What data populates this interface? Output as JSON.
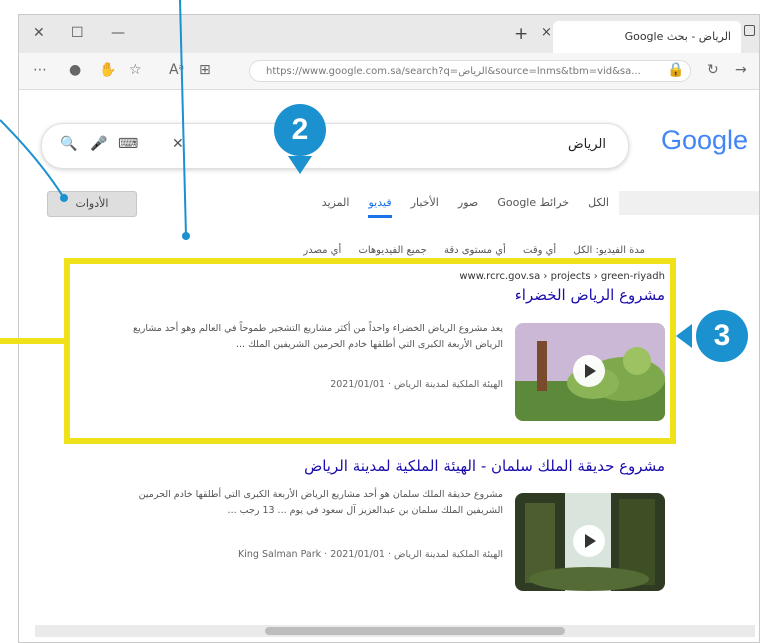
{
  "browser": {
    "tab_title": "الرياض - بحث Google",
    "url": "https://www.google.com.sa/search?q=الرياض&source=lnms&tbm=vid&sa...",
    "new_tab_symbol": "+",
    "close_symbol": "×"
  },
  "search": {
    "logo": "Google",
    "query": "الرياض"
  },
  "tabs": [
    {
      "label": "الكل",
      "active": false
    },
    {
      "label": "خرائط Google",
      "active": false
    },
    {
      "label": "صور",
      "active": false
    },
    {
      "label": "الأخبار",
      "active": false
    },
    {
      "label": "فيديو",
      "active": true
    },
    {
      "label": "المزيد",
      "active": false
    }
  ],
  "tools_label": "الأدوات",
  "filters": [
    "مدة الفيديو: الكل",
    "أي وقت",
    "أي مستوى دقة",
    "جميع الفيديوهات",
    "أي مصدر"
  ],
  "results": [
    {
      "breadcrumb": "www.rcrc.gov.sa › projects › green-riyadh",
      "title": "مشروع الرياض الخضراء",
      "snippet": "يعد مشروع الرياض الخضراء واحداً من أكثر مشاريع التشجير طموحاً في العالم وهو أحد مشاريع الرياض الأربعة الكبرى التي أطلقها خادم الحرمين الشريفين الملك ...",
      "source": "الهيئة الملكية لمدينة الرياض",
      "date": "2021/01/01"
    },
    {
      "breadcrumb": "",
      "title": "مشروع حديقة الملك سلمان - الهيئة الملكية لمدينة الرياض",
      "snippet": "مشروع حديقة الملك سلمان هو أحد مشاريع الرياض الأربعة الكبرى التي أطلقها خادم الحرمين الشريفين الملك سلمان بن عبدالعزيز آل سعود في يوم ... 13 رجب ...",
      "source": "الهيئة الملكية لمدينة الرياض · King Salman Park",
      "date": "2021/01/01"
    }
  ],
  "callouts": [
    "2",
    "3"
  ],
  "colors": {
    "accent": "#1a73e8",
    "callout": "#1b91cf",
    "highlight": "#f0e21a",
    "link": "#1a0dab"
  }
}
